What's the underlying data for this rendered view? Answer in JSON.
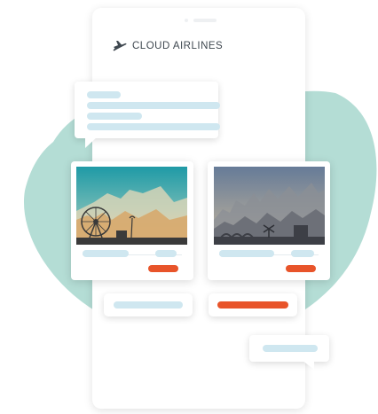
{
  "brand": {
    "name": "CLOUD AIRLINES",
    "icon": "airplane-icon"
  },
  "colors": {
    "blob": "#b4ddd5",
    "placeholder_bar": "#cfe7f0",
    "accent_orange": "#e8542a",
    "brand_text": "#3f4850"
  },
  "cards": [
    {
      "scene": "amusement-park-sunset-city"
    },
    {
      "scene": "european-city-bridge-dusk"
    }
  ]
}
